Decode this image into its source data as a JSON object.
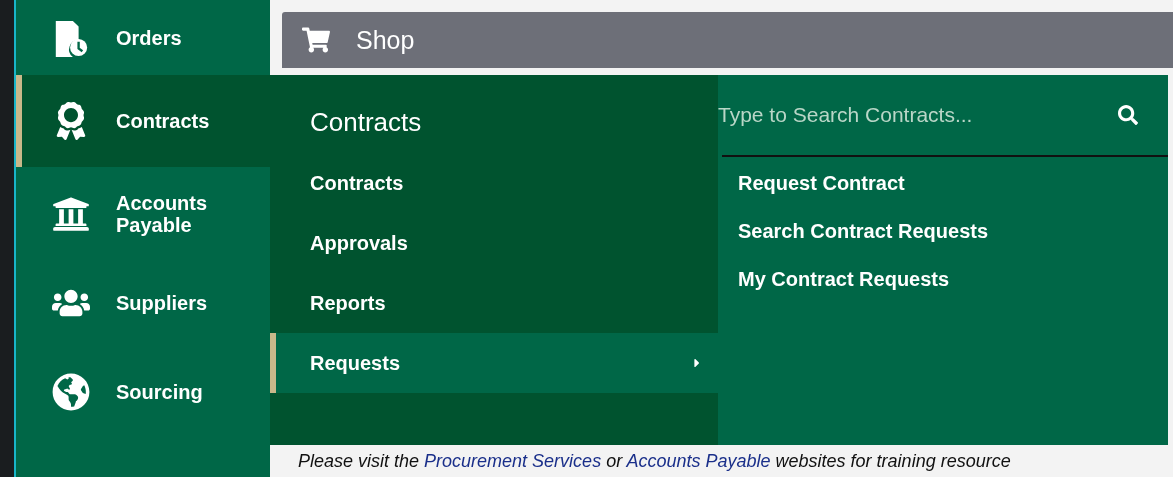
{
  "sidebar": {
    "items": [
      {
        "label": "Orders",
        "kind": "orders",
        "selected": false
      },
      {
        "label": "Contracts",
        "kind": "contracts",
        "selected": true
      },
      {
        "label": "Accounts Payable",
        "kind": "payable",
        "selected": false
      },
      {
        "label": "Suppliers",
        "kind": "suppliers",
        "selected": false
      },
      {
        "label": "Sourcing",
        "kind": "sourcing",
        "selected": false
      }
    ]
  },
  "header": {
    "title": "Shop"
  },
  "menu": {
    "title": "Contracts",
    "items": [
      {
        "label": "Contracts",
        "selected": false,
        "has_submenu": false
      },
      {
        "label": "Approvals",
        "selected": false,
        "has_submenu": false
      },
      {
        "label": "Reports",
        "selected": false,
        "has_submenu": false
      },
      {
        "label": "Requests",
        "selected": true,
        "has_submenu": true
      }
    ],
    "search": {
      "placeholder": "Type to Search Contracts..."
    },
    "links": [
      "Request Contract",
      "Search Contract Requests",
      "My Contract Requests"
    ]
  },
  "notice": [
    {
      "text": "Please visit the ",
      "kind": "plain"
    },
    {
      "text": "Procurement Services",
      "kind": "link"
    },
    {
      "text": " or ",
      "kind": "plain"
    },
    {
      "text": "Accounts Payable",
      "kind": "link"
    },
    {
      "text": " websites for training resource",
      "kind": "plain"
    }
  ]
}
